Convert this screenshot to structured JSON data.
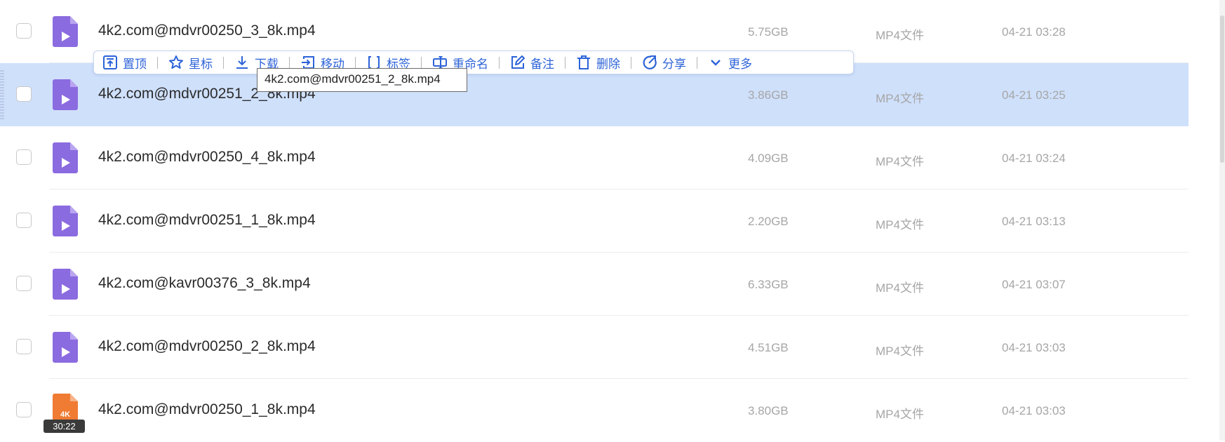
{
  "files": [
    {
      "name": "4k2.com@mdvr00250_3_8k.mp4",
      "size": "5.75GB",
      "type": "MP4文件",
      "date": "04-21 03:28",
      "icon": "mp4-file-icon",
      "selected": false
    },
    {
      "name": "4k2.com@mdvr00251_2_8k.mp4",
      "size": "3.86GB",
      "type": "MP4文件",
      "date": "04-21 03:25",
      "icon": "mp4-file-icon",
      "selected": true
    },
    {
      "name": "4k2.com@mdvr00250_4_8k.mp4",
      "size": "4.09GB",
      "type": "MP4文件",
      "date": "04-21 03:24",
      "icon": "mp4-file-icon",
      "selected": false
    },
    {
      "name": "4k2.com@mdvr00251_1_8k.mp4",
      "size": "2.20GB",
      "type": "MP4文件",
      "date": "04-21 03:13",
      "icon": "mp4-file-icon",
      "selected": false
    },
    {
      "name": "4k2.com@kavr00376_3_8k.mp4",
      "size": "6.33GB",
      "type": "MP4文件",
      "date": "04-21 03:07",
      "icon": "mp4-file-icon",
      "selected": false
    },
    {
      "name": "4k2.com@mdvr00250_2_8k.mp4",
      "size": "4.51GB",
      "type": "MP4文件",
      "date": "04-21 03:03",
      "icon": "mp4-file-icon",
      "selected": false
    },
    {
      "name": "4k2.com@mdvr00250_1_8k.mp4",
      "size": "3.80GB",
      "type": "MP4文件",
      "date": "04-21 03:03",
      "icon": "4k-video-thumb-icon",
      "selected": false,
      "badge": "4K",
      "duration": "30:22"
    }
  ],
  "toolbar": {
    "pin": "置顶",
    "star": "星标",
    "download": "下载",
    "move": "移动",
    "tag": "标签",
    "rename": "重命名",
    "note": "备注",
    "delete": "删除",
    "share": "分享",
    "more": "更多"
  },
  "tooltip": {
    "text": "4k2.com@mdvr00251_2_8k.mp4"
  },
  "colors": {
    "accent": "#2d63d8",
    "selection": "#cfe0fb",
    "mp4_icon": "#8b6be0",
    "thumb_4k": "#f07b32"
  }
}
